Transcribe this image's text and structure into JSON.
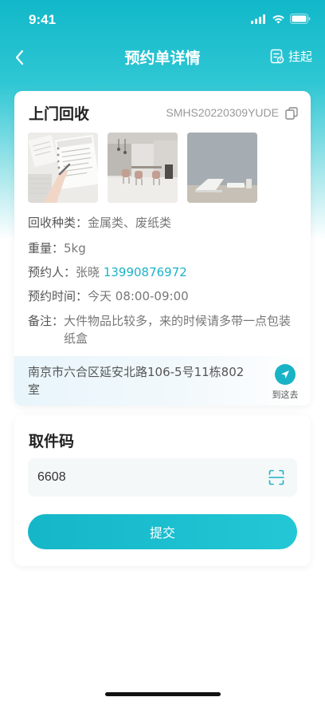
{
  "status_bar": {
    "time": "9:41"
  },
  "nav": {
    "title": "预约单详情",
    "action_label": "挂起"
  },
  "order": {
    "title": "上门回收",
    "number": "SMHS20220309YUDE",
    "photos": [
      "photo-notebook",
      "photo-office-interior",
      "photo-laptop-desk"
    ]
  },
  "info": {
    "kind_label": "回收种类：",
    "kind_value": "金属类、废纸类",
    "weight_label": "重量：",
    "weight_value": "5kg",
    "person_label": "预约人：",
    "person_name": "张晓",
    "person_phone": "13990876972",
    "time_label": "预约时间：",
    "time_value": "今天 08:00-09:00",
    "note_label": "备注：",
    "note_value": "大件物品比较多，来的时候请多带一点包装纸盒"
  },
  "address": {
    "text": "南京市六合区延安北路106-5号11栋802室",
    "go_label": "到这去"
  },
  "pickup": {
    "title": "取件码",
    "code_value": "6608",
    "submit_label": "提交"
  },
  "colors": {
    "accent": "#19b3c6",
    "phone": "#1bb3c5"
  }
}
